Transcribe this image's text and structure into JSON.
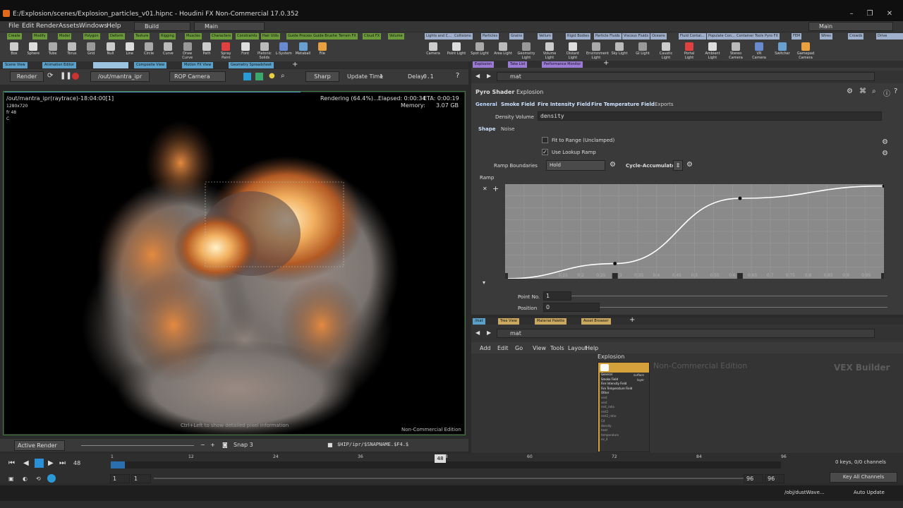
{
  "window": {
    "title": "E:/Explosion/scenes/Explosion_particles_v01.hipnc - Houdini FX Non-Commercial 17.0.352"
  },
  "menubar": {
    "items": [
      "File",
      "Edit",
      "Render",
      "Assets",
      "Windows",
      "Help"
    ],
    "desktop": "Build",
    "desk_main": "Main",
    "right_main": "Main"
  },
  "shelf_left": {
    "tabs": [
      "Create",
      "Modify",
      "Model",
      "Polygon",
      "Deform",
      "Texture",
      "Rigging",
      "Muscles",
      "Characters",
      "Constraints",
      "Hair Utils",
      "Guide Process",
      "Guide Brushes",
      "Terrain FX",
      "Cloud FX",
      "Volume"
    ],
    "tools": [
      "Box",
      "Sphere",
      "Tube",
      "Torus",
      "Grid",
      "Null",
      "Line",
      "Circle",
      "Curve",
      "Draw Curve",
      "Path",
      "Spray Paint",
      "Font",
      "Platonic Solids",
      "L-System",
      "Metaball",
      "File"
    ]
  },
  "shelf_right": {
    "tabs": [
      "Lights and C...",
      "Collisions",
      "Particles",
      "Grains",
      "Vellum",
      "Rigid Bodies",
      "Particle Fluids",
      "Viscous Fluids",
      "Oceans",
      "Fluid Contai...",
      "Populate Con...",
      "Container Tools",
      "Pyro FX",
      "FEM",
      "Wires",
      "Crowds",
      "Drive Simula..."
    ],
    "tools": [
      "Camera",
      "Point Light",
      "Spot Light",
      "Area Light",
      "Geometry Light",
      "Volume Light",
      "Distant Light",
      "Environment Light",
      "Sky Light",
      "GI Light",
      "Caustic Light",
      "Portal Light",
      "Ambient Light",
      "Stereo Camera",
      "VR Camera",
      "Switcher",
      "Gamepad Camera"
    ]
  },
  "viewer": {
    "tabs": [
      "Scene View",
      "Animation Editor",
      "",
      "Composite View",
      "Motion FX View",
      "Geometry Spreadsheet"
    ],
    "render_label": "Render",
    "rop_path": "/out/mantra_ipr",
    "rop_camera": "ROP Camera",
    "sharp": "Sharp",
    "update_time_label": "Update Time",
    "update_time_value": "1",
    "delay_label": "Delay",
    "delay_value": "0.1",
    "render_title": "/out/mantra_ipr(raytrace)-18:04:00[1]",
    "resolution": "1280x720",
    "frame": "fr 48",
    "channel": "C",
    "status": "Rendering (64.4%)...",
    "elapsed": "Elapsed: 0:00:34",
    "eta": "ETA: 0:00:19",
    "memory_label": "Memory:",
    "memory": "3.07 GB",
    "hint": "Ctrl+Left to show detailed pixel information",
    "watermark": "Non-Commercial Edition",
    "progress": 0.644
  },
  "viewer_bottom": {
    "mode": "Active Render",
    "snap": "Snap 3",
    "path": "$HIP/ipr/$SNAPNAME.$F4.$"
  },
  "timeline": {
    "current_frame": "48",
    "ticks": [
      "1",
      "12",
      "24",
      "36",
      "48",
      "60",
      "72",
      "84",
      "96"
    ],
    "start": "1",
    "start2": "1",
    "end": "96",
    "end2": "96",
    "keys_info": "0 keys, 0/0 channels",
    "key_all": "Key All Channels"
  },
  "status": {
    "path": "/obj/dustWave...",
    "auto_update": "Auto Update"
  },
  "param_panel": {
    "tabs": [
      "Explosion",
      "Take List",
      "Performance Monitor"
    ],
    "path": "mat",
    "node_type": "Pyro Shader",
    "node_name": "Explosion",
    "subtabs": [
      "General",
      "Smoke Field",
      "Fire Intensity Field",
      "Fire Temperature Field",
      "Exports"
    ],
    "density_label": "Density Volume",
    "density_value": "density",
    "shape_tabs": [
      "Shape",
      "Noise"
    ],
    "fit_range": "Fit to Range (Unclamped)",
    "use_ramp": "Use Lookup Ramp",
    "ramp_boundaries_label": "Ramp Boundaries",
    "ramp_boundaries": "Hold",
    "cycle": "Cycle-Accumulate",
    "ramp_label": "Ramp",
    "ramp_ticks": [
      "0.15",
      "0.2",
      "0.25",
      "0.3",
      "0.35",
      "0.4",
      "0.45",
      "0.5",
      "0.55",
      "0.6",
      "0.65",
      "0.7",
      "0.75",
      "0.8",
      "0.85",
      "0.9",
      "0.95"
    ],
    "ramp_points": [
      [
        0,
        0
      ],
      [
        0.29,
        0.16
      ],
      [
        0.62,
        0.85
      ],
      [
        1,
        0.98
      ]
    ],
    "point_no_label": "Point No.",
    "point_no": "1",
    "position_label": "Position",
    "position": "0"
  },
  "net_panel": {
    "tabs": [
      "/mat",
      "Tree View",
      "Material Palette",
      "Asset Browser"
    ],
    "path": "mat",
    "menu": [
      "Add",
      "Edit",
      "Go",
      "View",
      "Tools",
      "Layout",
      "Help"
    ],
    "watermark": "Non-Commercial Edition",
    "context": "VEX Builder",
    "node_title": "Explosion",
    "node_outputs": [
      "surface",
      "layer"
    ],
    "node_inputs": [
      "General",
      "Smoke Field",
      "Fire Intensity Field",
      "Fire Temperature Field",
      "Other",
      "vest",
      "vest",
      "rest_ratio",
      "rest2",
      "rest2_ratio",
      "Cd",
      "density",
      "heat",
      "temperature",
      "ev_4"
    ]
  }
}
